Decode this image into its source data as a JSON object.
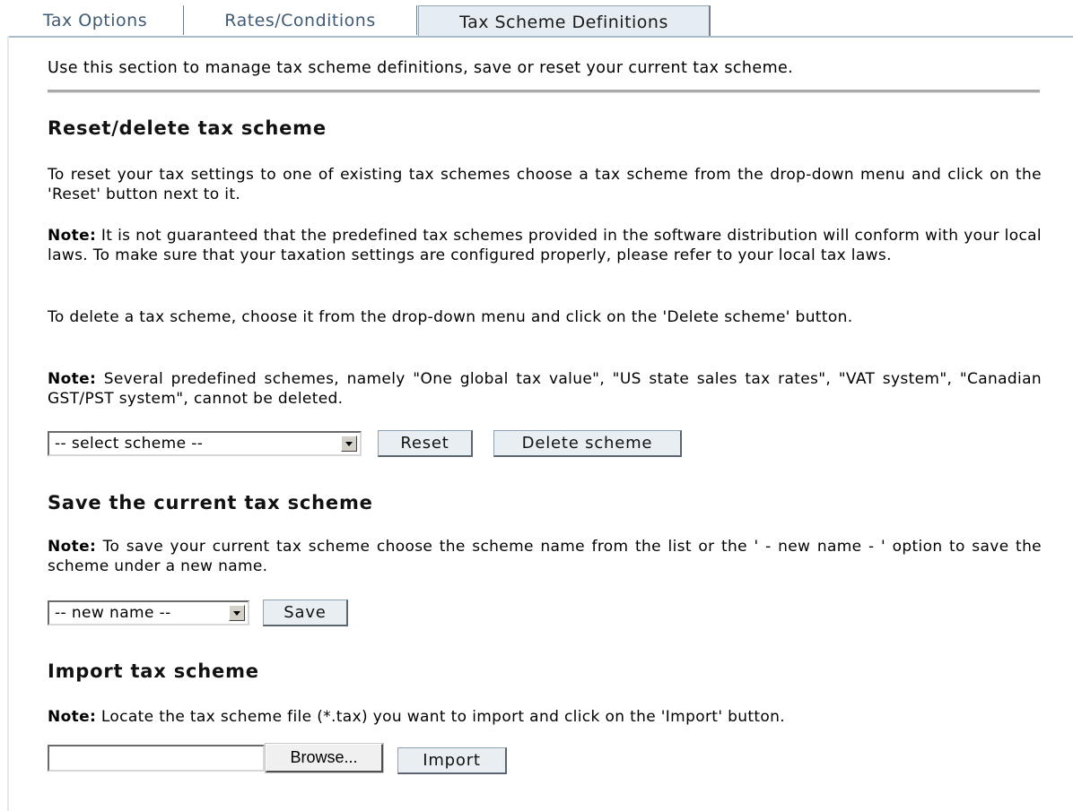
{
  "tabs": [
    "Tax Options",
    "Rates/Conditions",
    "Tax Scheme Definitions"
  ],
  "intro": "Use this section to manage tax scheme definitions, save or reset your current tax scheme.",
  "reset_section": {
    "heading": "Reset/delete tax scheme",
    "p1": "To reset your tax settings to one of existing tax schemes choose a tax scheme from the drop-down menu and click on the 'Reset' button next to it.",
    "note_label": "Note:",
    "p2": " It is not guaranteed that the predefined tax schemes provided  in the software distribution will conform with your local laws. To make sure that your taxation settings are configured properly, please refer to your local tax laws.",
    "p3": "To delete a tax scheme, choose it from the drop-down menu and click on the 'Delete scheme' button.",
    "p4": " Several predefined schemes, namely \"One global tax value\", \"US state sales tax rates\", \"VAT system\", \"Canadian GST/PST system\", cannot be deleted.",
    "select_value": "-- select scheme --",
    "reset_label": "Reset",
    "delete_label": "Delete scheme"
  },
  "save_section": {
    "heading": "Save the current tax scheme",
    "note_label": "Note:",
    "p1": " To save your current tax scheme choose the scheme name from the list or the ' - new name - ' option to save the scheme under a new name.",
    "select_value": "-- new name --",
    "save_label": "Save"
  },
  "import_section": {
    "heading": "Import tax scheme",
    "note_label": "Note:",
    "p1": " Locate the tax scheme file (*.tax) you want to import and click on the 'Import' button.",
    "file_value": "",
    "browse_label": "Browse...",
    "import_label": "Import"
  }
}
